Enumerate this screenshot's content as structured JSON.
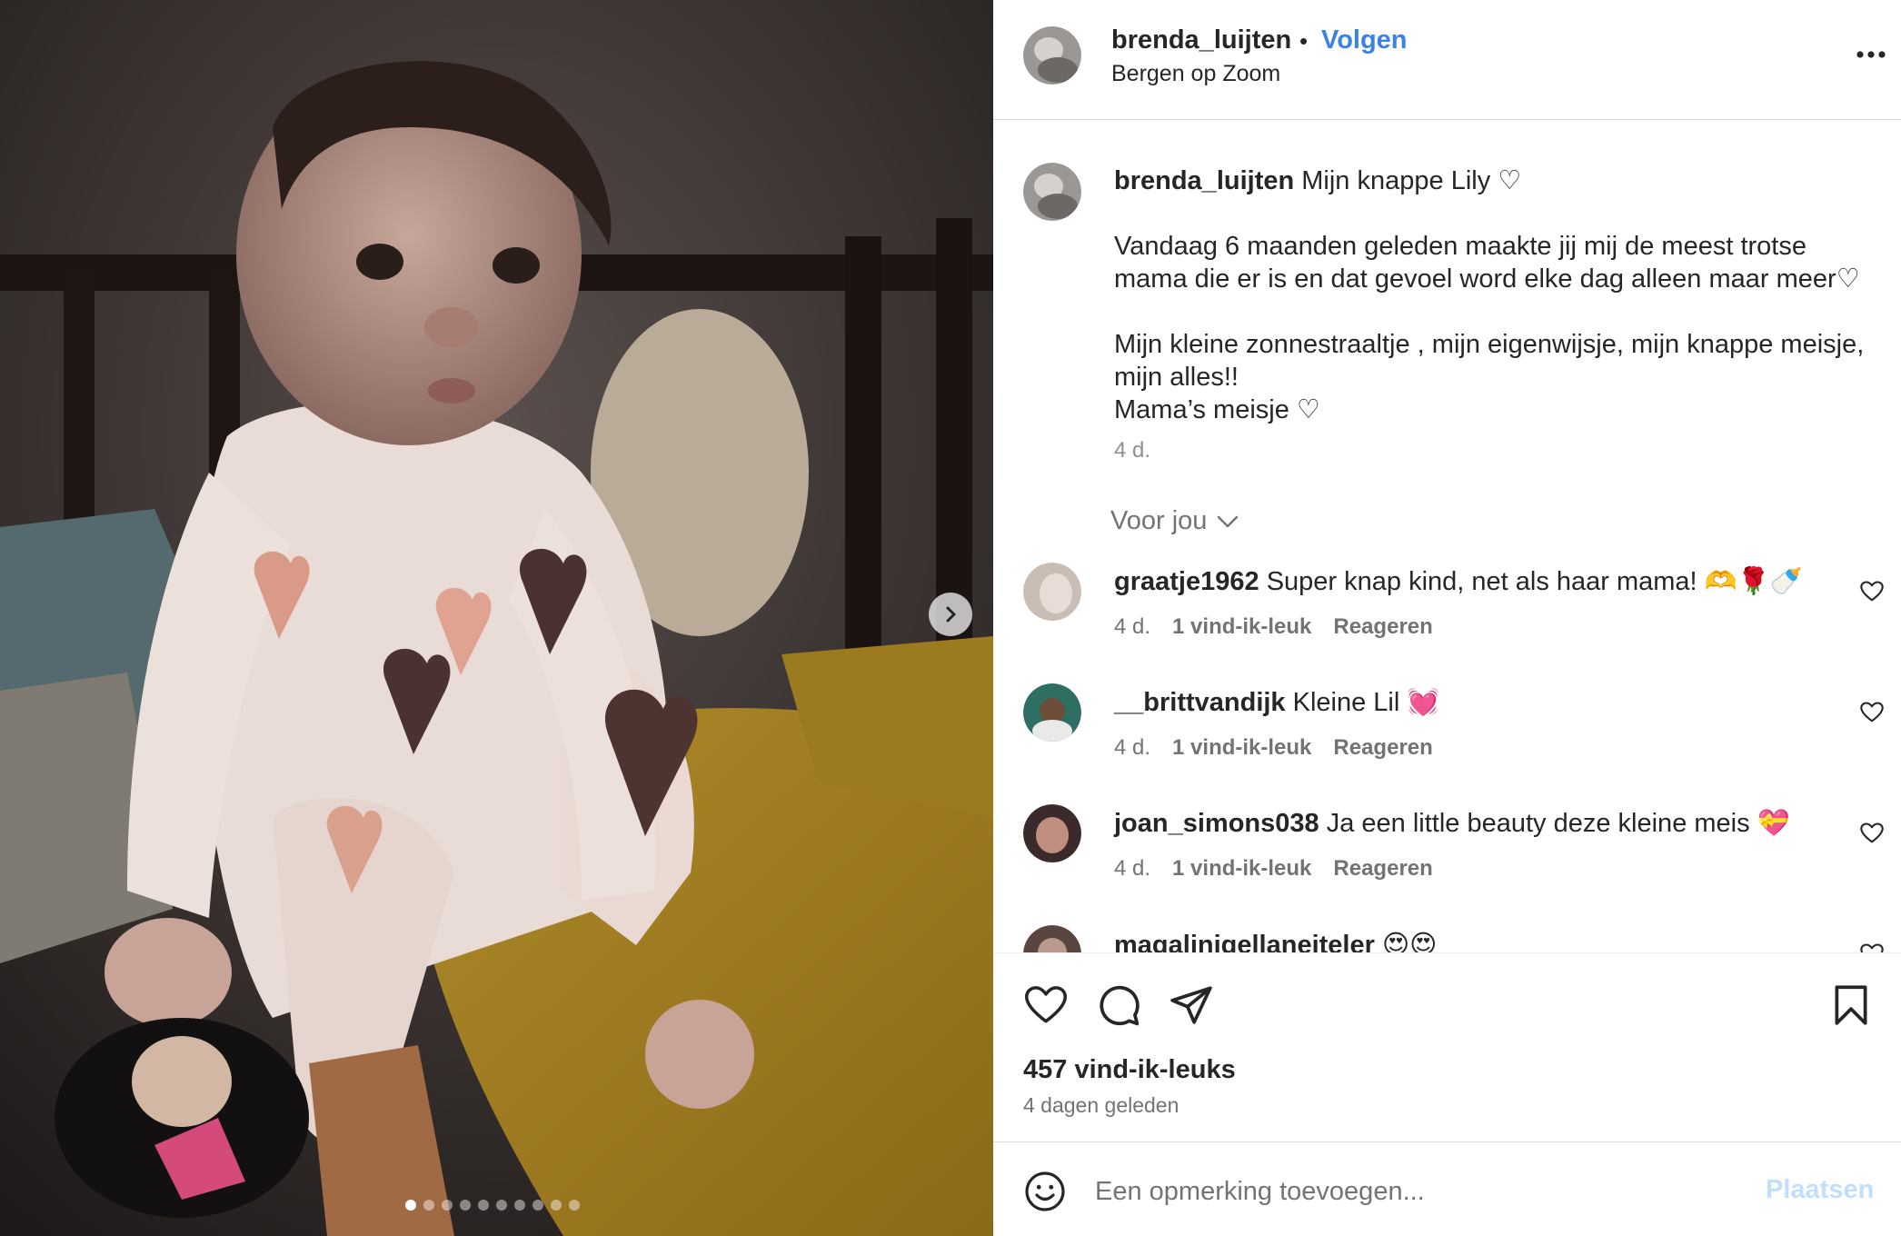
{
  "post": {
    "username": "brenda_luijten",
    "follow_label": "Volgen",
    "separator": "•",
    "location": "Bergen op Zoom",
    "caption_lines": [
      "Mijn knappe Lily ♡",
      "Vandaag 6 maanden geleden maakte jij mij de meest trotse mama die er is en dat gevoel word elke dag alleen maar meer♡",
      "Mijn kleine zonnestraaltje , mijn eigenwijsje, mijn knappe meisje, mijn alles!!",
      "Mama’s meisje ♡"
    ],
    "caption_time": "4 d.",
    "for_you_label": "Voor jou",
    "likes": "457 vind-ik-leuks",
    "date": "4 dagen geleden",
    "carousel": {
      "slides": 10,
      "active": 0
    }
  },
  "comments": [
    {
      "username": "graatje1962",
      "text": "Super knap kind, net als haar mama! 🫶🌹🍼",
      "time": "4 d.",
      "likes": "1 vind-ik-leuk",
      "reply": "Reageren"
    },
    {
      "username": "__brittvandijk",
      "text": "Kleine Lil 💓",
      "time": "4 d.",
      "likes": "1 vind-ik-leuk",
      "reply": "Reageren"
    },
    {
      "username": "joan_simons038",
      "text": "Ja een little beauty deze kleine meis 💝",
      "time": "4 d.",
      "likes": "1 vind-ik-leuk",
      "reply": "Reageren"
    },
    {
      "username": "magalinigellaneiteler",
      "text": "😍😍",
      "time": "",
      "likes": "",
      "reply": ""
    }
  ],
  "composer": {
    "placeholder": "Een opmerking toevoegen...",
    "post_label": "Plaatsen"
  },
  "icons": [
    "chevron-right-icon",
    "more-icon",
    "chevron-down-icon",
    "heart-icon",
    "comment-icon",
    "share-icon",
    "bookmark-icon",
    "emoji-icon"
  ],
  "colors": {
    "link": "#3b82e6",
    "secondary_text": "#737373",
    "post_disabled": "#c0dffd"
  }
}
